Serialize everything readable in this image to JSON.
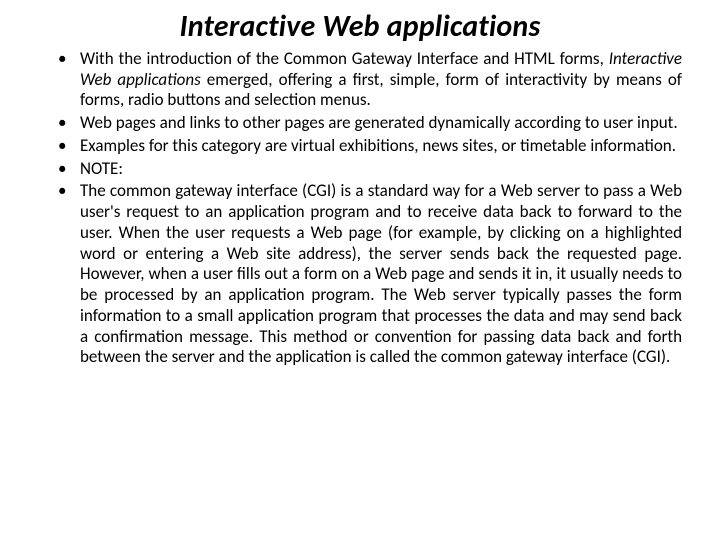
{
  "title": "Interactive Web applications",
  "bullets": [
    {
      "pre": "With the introduction of the Common Gateway Interface and HTML forms, ",
      "em": "Interactive Web applications",
      "post": " emerged, offering a first, simple, form of interactivity by means of forms, radio buttons and selection menus.",
      "justify": true
    },
    {
      "text": "Web pages and links to other pages are generated dynamically according to user input.",
      "justify": false
    },
    {
      "text": "Examples for this category are virtual exhibitions, news sites, or timetable information.",
      "justify": false
    },
    {
      "text": "NOTE:",
      "justify": false
    },
    {
      "text": "The common gateway interface (CGI) is a standard way for a Web server to pass a Web user's request to an application program and to receive data back to forward to the user. When the user requests a Web page (for example, by clicking on a highlighted word or entering a Web site address), the server sends back the requested page. However, when a user fills out a form on a Web page and sends it in, it usually needs to be processed by an application program. The Web server typically passes the form information to a small application program that processes the data and may send back a confirmation message. This method or convention for passing data back and forth between the server and the application is called the common gateway interface (CGI).",
      "justify": true
    }
  ]
}
